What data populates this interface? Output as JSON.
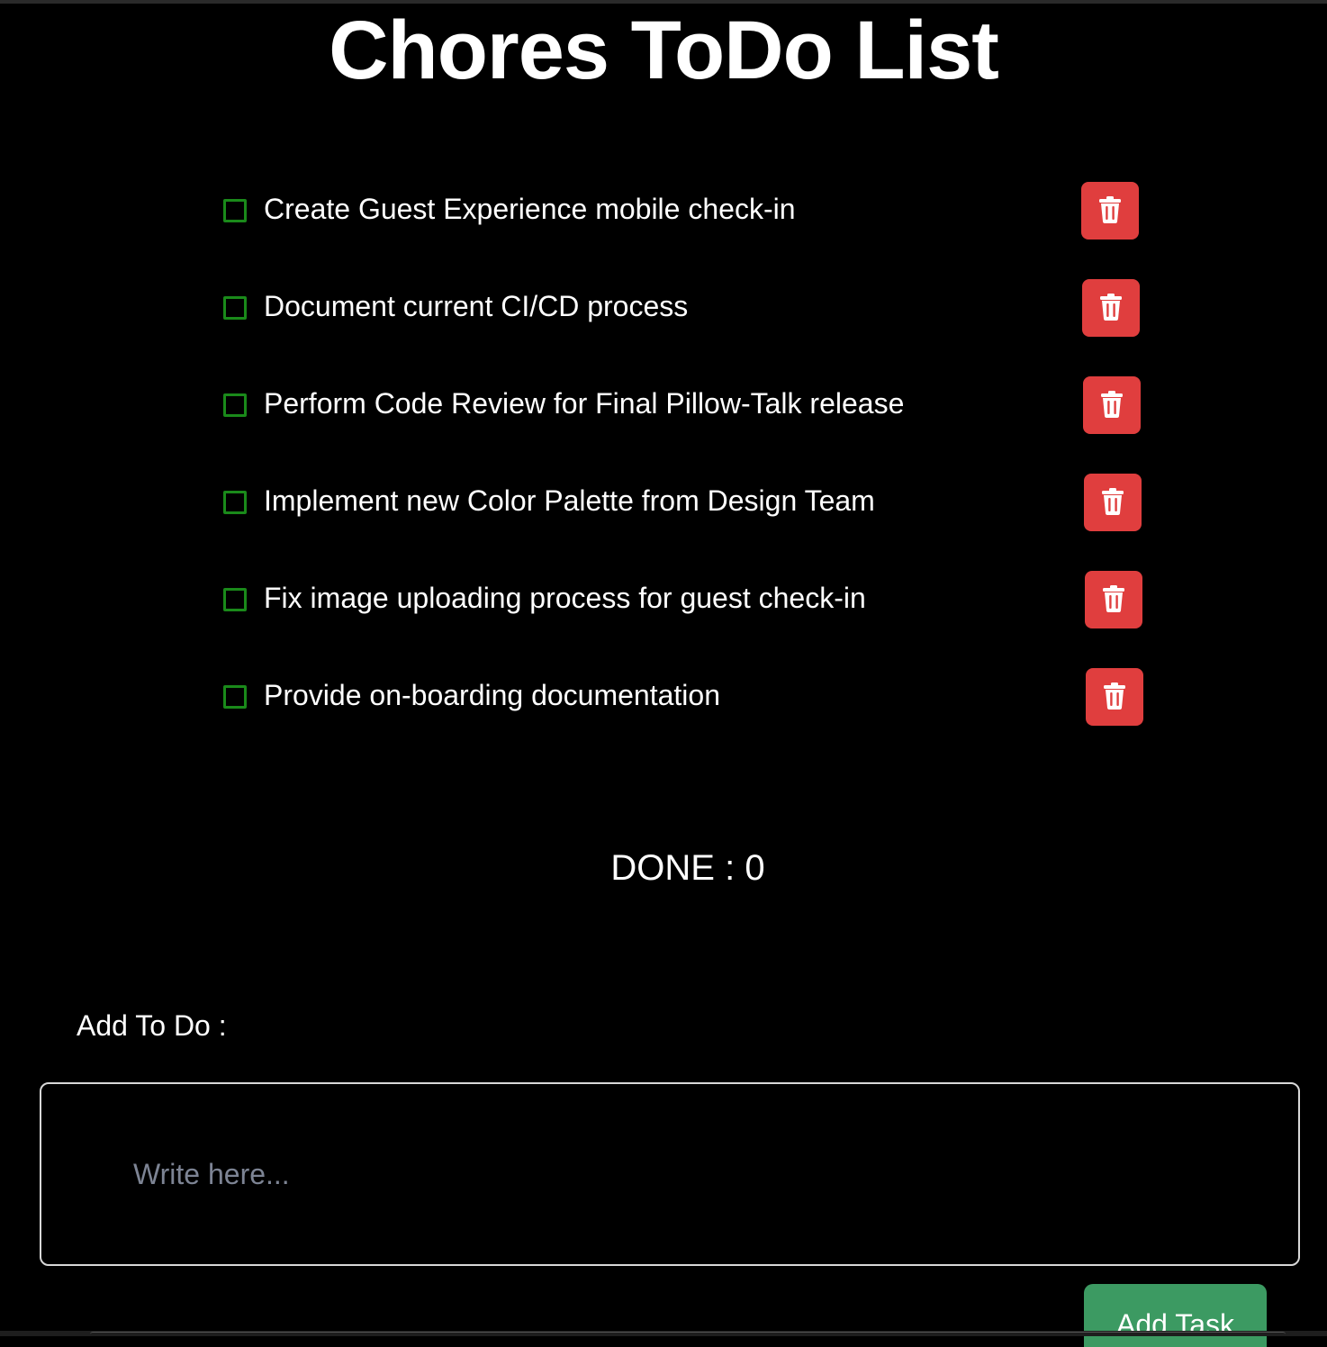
{
  "app": {
    "title": "Chores ToDo List"
  },
  "tasks": [
    {
      "label": "Create Guest Experience mobile check-in",
      "checked": false,
      "delete_icon": "trash-icon"
    },
    {
      "label": "Document current CI/CD process",
      "checked": false,
      "delete_icon": "trash-icon"
    },
    {
      "label": "Perform Code Review for Final Pillow-Talk release",
      "checked": false,
      "delete_icon": "trash-icon"
    },
    {
      "label": "Implement new Color Palette from Design Team",
      "checked": false,
      "delete_icon": "trash-icon"
    },
    {
      "label": "Fix image uploading process for guest check-in",
      "checked": false,
      "delete_icon": "trash-icon"
    },
    {
      "label": "Provide on-boarding documentation",
      "checked": false,
      "delete_icon": "trash-icon"
    }
  ],
  "summary": {
    "done_text": "DONE : 0",
    "done_count": 0
  },
  "add_form": {
    "label": "Add To Do :",
    "input_value": "",
    "placeholder": "Write here...",
    "button_label": "Add Task"
  },
  "colors": {
    "background": "#000000",
    "checkbox_border": "#1a8a1a",
    "delete_button": "#e03e3e",
    "add_button": "#3c9a62",
    "placeholder": "#7d8494"
  }
}
